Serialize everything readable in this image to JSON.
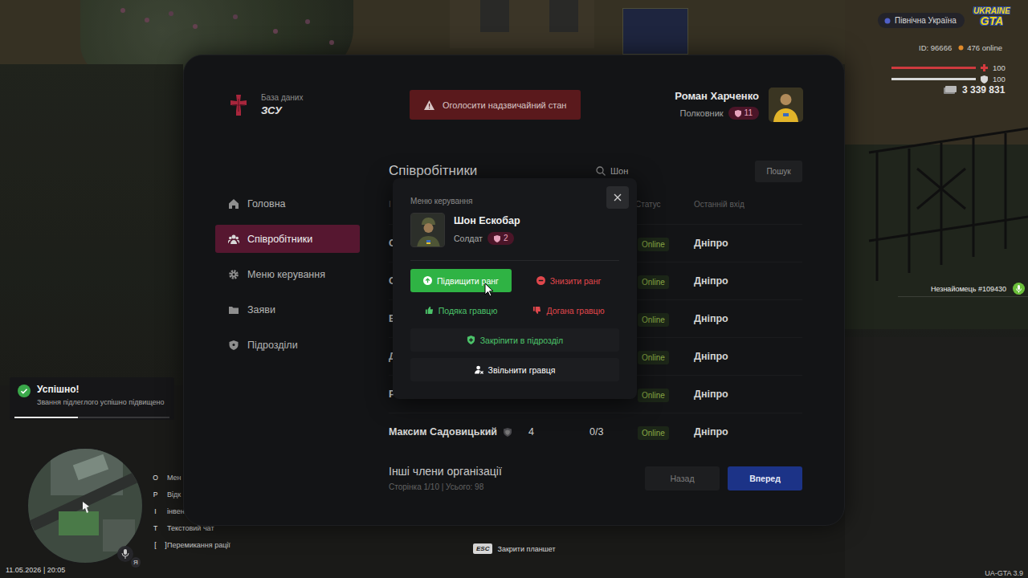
{
  "hud": {
    "region": "Північна Україна",
    "logo": [
      "UKRAINE",
      "GTA"
    ],
    "player_id": "ID: 96666",
    "online": "476 online",
    "health": {
      "value": "100",
      "level": 1
    },
    "armor": {
      "value": "100",
      "level": 1
    },
    "money": "3 339 831",
    "nametag": "Незнайомець #109430",
    "keybinds": [
      {
        "keys": [
          "O"
        ],
        "label": "Мен"
      },
      {
        "keys": [
          "P"
        ],
        "label": "Відк"
      },
      {
        "keys": [
          "I"
        ],
        "label": "інвент"
      },
      {
        "keys": [
          "T"
        ],
        "label": "Текстовий чат"
      },
      {
        "keys": [
          "[",
          "]"
        ],
        "label": "Перемикання рації"
      }
    ],
    "voice_badge": "Я",
    "date_time": "11.05.2026 | 20:05",
    "close_hint": {
      "key": "ESC",
      "label": "Закрити планшет"
    },
    "version": "UA-GTA 3.9"
  },
  "notification": {
    "title": "Успішно!",
    "message": "Звання підлеглого успішно підвищено",
    "level": 0.41
  },
  "tablet": {
    "org": {
      "subtitle": "База даних",
      "title": "ЗСУ"
    },
    "emergency_button": "Оголосити надзвичайний стан",
    "user": {
      "name": "Роман Харченко",
      "rank": "Полковник",
      "rank_level": "11"
    },
    "sidebar": [
      {
        "label": "Головна",
        "selected": false
      },
      {
        "label": "Співробітники",
        "selected": true
      },
      {
        "label": "Меню керування",
        "selected": false
      },
      {
        "label": "Заяви",
        "selected": false
      },
      {
        "label": "Підрозділи",
        "selected": false
      }
    ],
    "page_title": "Співробітники",
    "search": {
      "value": "Шон",
      "button": "Пошук"
    },
    "table": {
      "columns": [
        "І",
        "Статус",
        "Останній вхід"
      ],
      "rows": [
        {
          "name": "С",
          "badge": false,
          "status": "Online",
          "last_login": "Дніпро"
        },
        {
          "name": "С",
          "badge": false,
          "status": "Online",
          "last_login": "Дніпро"
        },
        {
          "name": "В",
          "badge": false,
          "status": "Online",
          "last_login": "Дніпро"
        },
        {
          "name": "Д",
          "badge": false,
          "status": "Online",
          "last_login": "Дніпро"
        },
        {
          "name": "Р",
          "badge": false,
          "status": "Online",
          "last_login": "Дніпро"
        },
        {
          "name": "Максим Садовицький",
          "badge": true,
          "rank": "4",
          "warnings": "0/3",
          "status": "Online",
          "last_login": "Дніпро"
        }
      ]
    },
    "footer": {
      "title": "Інші члени організації",
      "info": "Сторінка 1/10 | Усього: 98",
      "buttons": [
        {
          "label": "Назад",
          "primary": false
        },
        {
          "label": "Вперед",
          "primary": true
        }
      ]
    }
  },
  "modal": {
    "title": "Меню керування",
    "player": {
      "name": "Шон Ескобар",
      "rank": "Солдат",
      "rank_level": "2"
    },
    "actions": [
      {
        "label": "Підвищити ранг",
        "kind": "filled",
        "color": "#2fb344"
      },
      {
        "label": "Знизити ранг",
        "kind": "plain",
        "color": "#e0474c"
      },
      {
        "label": "Подяка гравцю",
        "kind": "plain",
        "color": "#4cc36a"
      },
      {
        "label": "Догана гравцю",
        "kind": "plain",
        "color": "#e0474c"
      },
      {
        "label": "Закріпити в підрозділ",
        "kind": "wide",
        "color": "#4cc36a"
      },
      {
        "label": "Звільнити гравця",
        "kind": "wide",
        "color": "#ffffff"
      }
    ]
  }
}
